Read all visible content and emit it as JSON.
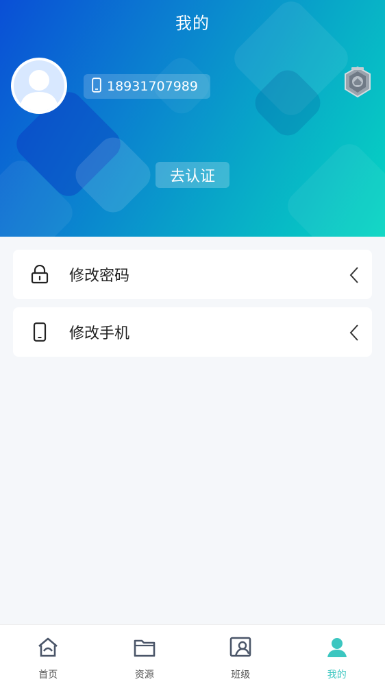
{
  "header": {
    "title": "我的",
    "phone": "18931707989",
    "verify_label": "去认证"
  },
  "menu": [
    {
      "label": "修改密码",
      "icon": "lock-icon"
    },
    {
      "label": "修改手机",
      "icon": "phone-icon"
    }
  ],
  "tabbar": {
    "items": [
      {
        "label": "首页",
        "icon": "home-icon"
      },
      {
        "label": "资源",
        "icon": "folder-icon"
      },
      {
        "label": "班级",
        "icon": "class-icon"
      },
      {
        "label": "我的",
        "icon": "user-icon"
      }
    ],
    "active_index": 3
  },
  "colors": {
    "accent": "#3cc6c0",
    "header_start": "#0a4fd6",
    "header_end": "#06d6c2"
  }
}
